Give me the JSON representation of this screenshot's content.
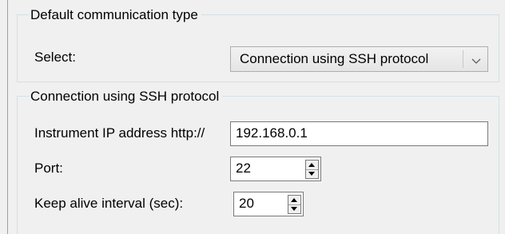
{
  "default_group": {
    "legend": "Default communication type",
    "select_label": "Select:",
    "select_value": "Connection using SSH protocol"
  },
  "ssh_group": {
    "legend": "Connection using SSH protocol",
    "ip_label": "Instrument IP address http://",
    "ip_value": "192.168.0.1",
    "port_label": "Port:",
    "port_value": "22",
    "keepalive_label": "Keep alive interval (sec):",
    "keepalive_value": "20"
  },
  "icons": {
    "combo_arrow": "chevron-down-icon",
    "spin_up": "triangle-up-icon",
    "spin_down": "triangle-down-icon"
  }
}
